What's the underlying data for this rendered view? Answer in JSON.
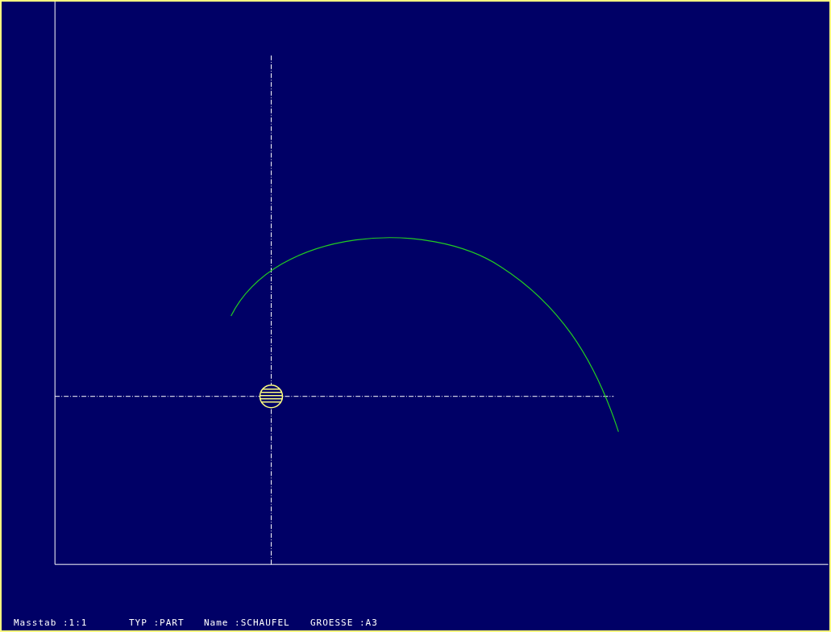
{
  "status_bar": [
    {
      "label": "Masstab :1:1"
    },
    {
      "label": "TYP :PART"
    },
    {
      "label": "Name :SCHAUFEL"
    },
    {
      "label": "GROESSE :A3"
    }
  ]
}
